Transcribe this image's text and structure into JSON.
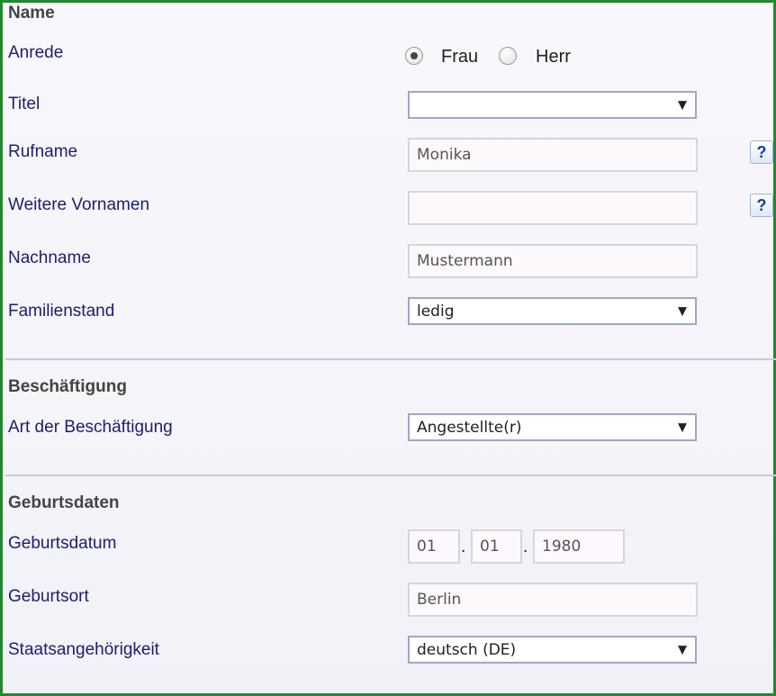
{
  "sections": {
    "name": "Name",
    "employment": "Beschäftigung",
    "birth": "Geburtsdaten"
  },
  "labels": {
    "anrede": "Anrede",
    "titel": "Titel",
    "rufname": "Rufname",
    "weitere_vornamen": "Weitere Vornamen",
    "nachname": "Nachname",
    "familienstand": "Familienstand",
    "art_beschaeftigung": "Art der Beschäftigung",
    "geburtsdatum": "Geburtsdatum",
    "geburtsort": "Geburtsort",
    "staatsangehoerigkeit": "Staatsangehörigkeit"
  },
  "anrede": {
    "options": [
      "Frau",
      "Herr"
    ],
    "selected": "Frau"
  },
  "fields": {
    "titel": "",
    "rufname": "Monika",
    "weitere_vornamen": "",
    "nachname": "Mustermann",
    "familienstand": "ledig",
    "art_beschaeftigung": "Angestellte(r)",
    "geburtsdatum": {
      "day": "01",
      "month": "01",
      "year": "1980",
      "separator": "."
    },
    "geburtsort": "Berlin",
    "staatsangehoerigkeit": "deutsch (DE)"
  },
  "icons": {
    "dropdown_caret": "▼",
    "help": "?"
  },
  "colors": {
    "frame": "#1f8a2b",
    "label": "#1c1e6e",
    "section_title": "#444444"
  }
}
